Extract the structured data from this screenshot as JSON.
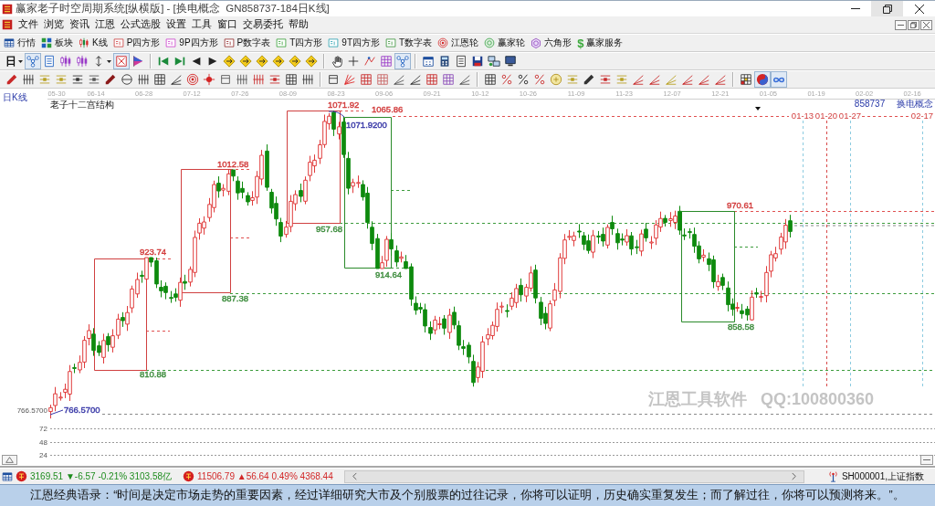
{
  "window": {
    "title": "赢家老子时空周期系统[纵横版] - [换电概念  GN858737-184日K线]",
    "restore_highlighted": true
  },
  "menu": [
    "文件",
    "浏览",
    "资讯",
    "江恩",
    "公式选股",
    "设置",
    "工具",
    "窗口",
    "交易委托",
    "帮助"
  ],
  "main_toolbar": [
    {
      "label": "行情"
    },
    {
      "label": "板块"
    },
    {
      "label": "K线"
    },
    {
      "label": "P四方形"
    },
    {
      "label": "9P四方形"
    },
    {
      "label": "P数字表"
    },
    {
      "label": "T四方形"
    },
    {
      "label": "9T四方形"
    },
    {
      "label": "T数字表"
    },
    {
      "label": "江恩轮"
    },
    {
      "label": "赢家轮"
    },
    {
      "label": "六角形"
    },
    {
      "label": "赢家服务",
      "icon_char": "$"
    }
  ],
  "toolbar_2": [
    {
      "kind": "button",
      "label": "日",
      "dropdown": true,
      "pressed": false
    },
    {
      "kind": "button",
      "dropdown": false,
      "pressed": true
    },
    {
      "kind": "button",
      "dropdown": false,
      "pressed": false
    },
    {
      "kind": "button",
      "dropdown": false,
      "pressed": false
    },
    {
      "kind": "button",
      "dropdown": false,
      "pressed": false
    },
    {
      "kind": "button",
      "dropdown": true,
      "pressed": false
    },
    {
      "kind": "button",
      "dropdown": false,
      "pressed": true
    },
    {
      "kind": "button",
      "dropdown": false,
      "pressed": false
    },
    {
      "kind": "separator"
    },
    {
      "kind": "button",
      "dropdown": false,
      "pressed": false
    },
    {
      "kind": "button",
      "dropdown": false,
      "pressed": false
    },
    {
      "kind": "button",
      "dropdown": false,
      "pressed": false
    },
    {
      "kind": "button",
      "dropdown": false,
      "pressed": false
    },
    {
      "kind": "button",
      "dropdown": false,
      "pressed": false
    },
    {
      "kind": "button",
      "dropdown": false,
      "pressed": false
    },
    {
      "kind": "button",
      "dropdown": false,
      "pressed": false
    },
    {
      "kind": "button",
      "dropdown": false,
      "pressed": false
    },
    {
      "kind": "button",
      "dropdown": false,
      "pressed": false
    },
    {
      "kind": "button",
      "dropdown": false,
      "pressed": false
    },
    {
      "kind": "separator"
    },
    {
      "kind": "button",
      "dropdown": false,
      "pressed": false
    },
    {
      "kind": "button",
      "dropdown": false,
      "pressed": false
    },
    {
      "kind": "button",
      "dropdown": false,
      "pressed": false
    },
    {
      "kind": "button",
      "dropdown": false,
      "pressed": false
    },
    {
      "kind": "button",
      "dropdown": false,
      "pressed": true
    },
    {
      "kind": "separator"
    },
    {
      "kind": "button",
      "dropdown": false,
      "pressed": false
    },
    {
      "kind": "button",
      "dropdown": false,
      "pressed": false
    },
    {
      "kind": "button",
      "dropdown": false,
      "pressed": false
    },
    {
      "kind": "button",
      "dropdown": false,
      "pressed": false
    },
    {
      "kind": "button",
      "dropdown": false,
      "pressed": false
    },
    {
      "kind": "button",
      "dropdown": false,
      "pressed": false
    }
  ],
  "toolbar_3": [
    {
      "kind": "button",
      "pressed": false
    },
    {
      "kind": "button",
      "pressed": false
    },
    {
      "kind": "button",
      "pressed": false
    },
    {
      "kind": "button",
      "pressed": false
    },
    {
      "kind": "button",
      "pressed": false
    },
    {
      "kind": "button",
      "pressed": false
    },
    {
      "kind": "button",
      "pressed": false
    },
    {
      "kind": "button",
      "pressed": false
    },
    {
      "kind": "button",
      "pressed": false
    },
    {
      "kind": "button",
      "pressed": false
    },
    {
      "kind": "button",
      "pressed": false
    },
    {
      "kind": "button",
      "pressed": false
    },
    {
      "kind": "button",
      "pressed": false
    },
    {
      "kind": "button",
      "pressed": false
    },
    {
      "kind": "button",
      "pressed": false
    },
    {
      "kind": "button",
      "pressed": false
    },
    {
      "kind": "button",
      "pressed": false
    },
    {
      "kind": "button",
      "pressed": false
    },
    {
      "kind": "button",
      "pressed": false
    },
    {
      "kind": "separator"
    },
    {
      "kind": "button",
      "pressed": false
    },
    {
      "kind": "button",
      "pressed": false
    },
    {
      "kind": "button",
      "pressed": false
    },
    {
      "kind": "button",
      "pressed": false
    },
    {
      "kind": "button",
      "pressed": false
    },
    {
      "kind": "button",
      "pressed": false
    },
    {
      "kind": "button",
      "pressed": false
    },
    {
      "kind": "button",
      "pressed": false
    },
    {
      "kind": "button",
      "pressed": false
    },
    {
      "kind": "separator"
    },
    {
      "kind": "button",
      "pressed": false
    },
    {
      "kind": "button",
      "pressed": false
    },
    {
      "kind": "button",
      "pressed": false
    },
    {
      "kind": "button",
      "pressed": false
    },
    {
      "kind": "button",
      "pressed": false
    },
    {
      "kind": "button",
      "pressed": false
    },
    {
      "kind": "button",
      "pressed": false
    },
    {
      "kind": "button",
      "pressed": false
    },
    {
      "kind": "button",
      "pressed": false
    },
    {
      "kind": "button",
      "pressed": false
    },
    {
      "kind": "button",
      "pressed": false
    },
    {
      "kind": "button",
      "pressed": false
    },
    {
      "kind": "button",
      "pressed": false
    },
    {
      "kind": "button",
      "pressed": false
    },
    {
      "kind": "button",
      "pressed": false
    },
    {
      "kind": "separator"
    },
    {
      "kind": "button",
      "pressed": false
    },
    {
      "kind": "button",
      "pressed": true
    },
    {
      "kind": "button",
      "pressed": true
    }
  ],
  "chart": {
    "period": "日K线",
    "date_axis": [
      "05-30",
      "06-14",
      "06-28",
      "07-12",
      "07-26",
      "08-09",
      "08-23",
      "09-06",
      "09-21",
      "10-12",
      "10-26",
      "11-09",
      "11-23",
      "12-07",
      "12-21",
      "01-05",
      "01-19",
      "02-02",
      "02-16"
    ],
    "title": "老子十二宫结构",
    "security": "858737 换电概念",
    "price_labels": [
      {
        "text": "1071.92",
        "color": "#d23c3c"
      },
      {
        "text": "1065.86",
        "color": "#d23c3c"
      },
      {
        "text": "1071.9200",
        "color": "#3a3aa8"
      },
      {
        "text": "1012.58",
        "color": "#d23c3c"
      },
      {
        "text": "923.74",
        "color": "#d23c3c"
      },
      {
        "text": "957.68",
        "color": "#3c8c3c"
      },
      {
        "text": "914.64",
        "color": "#3c8c3c"
      },
      {
        "text": "887.38",
        "color": "#3c8c3c"
      },
      {
        "text": "810.88",
        "color": "#3c8c3c"
      },
      {
        "text": "970.61",
        "color": "#d23c3c"
      },
      {
        "text": "858.58",
        "color": "#3c8c3c"
      },
      {
        "text": "766.5700",
        "color": "#3a3aa8"
      }
    ],
    "projection_dates": [
      "01-13",
      "01-20",
      "01-27",
      "02-17"
    ],
    "price_axis_label": "766.5700",
    "volume_axis": [
      "72",
      "48",
      "24"
    ],
    "watermark": "江恩工具软件 QQ:100800360"
  },
  "status_bar": {
    "indices": [
      {
        "text": "3169.51 ▼-6.57 -0.21% 3103.58亿",
        "color": "#1e8c1e"
      },
      {
        "text": "11506.79 ▲56.64 0.49% 4368.44",
        "color": "#d22828"
      }
    ],
    "security": "SH000001,上证指数"
  },
  "quote": "江恩经典语录：“时间是决定市场走势的重要因素，经过详细研究大市及个别股票的过往记录，你将可以证明，历史确实重复发生；而了解过往，你将可以预测将来。”。"
}
